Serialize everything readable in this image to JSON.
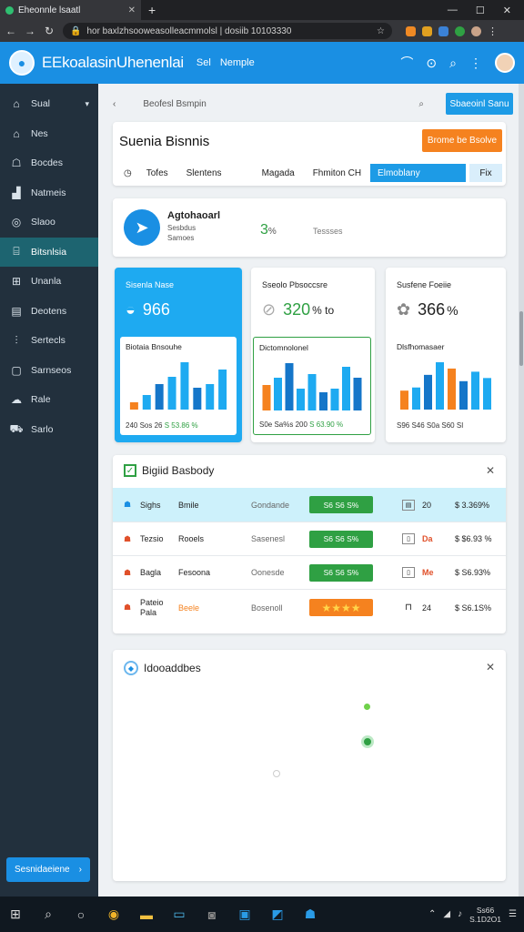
{
  "browser": {
    "tab_title": "Eheonnle lsaatl",
    "address": "hor baxlzhsooweasolleacmmolsl | dosiib 10103330"
  },
  "app": {
    "name": "EEkoalasinUhenenlai",
    "nav": [
      "Sel",
      "Nemple"
    ]
  },
  "sidebar": {
    "items": [
      {
        "label": "Sual",
        "icon": "dashboard-icon"
      },
      {
        "label": "Nes",
        "icon": "home-icon"
      },
      {
        "label": "Bocdes",
        "icon": "box-icon"
      },
      {
        "label": "Natmeis",
        "icon": "chart-icon"
      },
      {
        "label": "Slaoo",
        "icon": "settings-icon"
      },
      {
        "label": "Bitsnlsia",
        "icon": "building-icon",
        "active": true
      },
      {
        "label": "Unanla",
        "icon": "table-icon"
      },
      {
        "label": "Deotens",
        "icon": "calendar-icon"
      },
      {
        "label": "Sertecls",
        "icon": "analytics-icon"
      },
      {
        "label": "Sarnseos",
        "icon": "book-icon"
      },
      {
        "label": "Rale",
        "icon": "cloud-icon"
      },
      {
        "label": "Sarlo",
        "icon": "cart-icon"
      }
    ],
    "cta": "Sesnidaeiene"
  },
  "topbar": {
    "breadcrumb": "Beofesl Bsmpin",
    "action_button": "Sbaeoinl Sanu"
  },
  "hero": {
    "title": "Suenia Bisnnis",
    "orange_button": "Brome be Bsolve",
    "tabs": [
      "Tofes",
      "Slentens",
      "Magada",
      "Fhmiton CH",
      "Elmoblany",
      "Fix"
    ]
  },
  "overview": {
    "name": "Agtohaoarl",
    "sub1": "Sesbdus",
    "sub2": "Samoes",
    "pct": "3",
    "pct_unit": "%",
    "label": "Tessses"
  },
  "stats": [
    {
      "head": "Sisenla Nase",
      "value": "966",
      "chart_title": "Biotaia Bnsouhe",
      "footer": "240 Sos 26",
      "footer_green": "S 53.86 %",
      "bars": [
        2,
        4,
        7,
        9,
        13,
        6,
        7,
        11
      ]
    },
    {
      "head": "Sseolo Pbsoccsre",
      "value": "320",
      "unit": "% to",
      "chart_title": "Dictomnolonel",
      "footer": "S0e Sa%s 200",
      "footer_green": "S 63.90 %",
      "bars": [
        7,
        9,
        13,
        6,
        10,
        5,
        6,
        12,
        9
      ]
    },
    {
      "head": "Susfene Foeiie",
      "value": "366",
      "unit": "%",
      "chart_title": "Dlsfhomasaer",
      "footer": "S96 S46 S0a S60 SI",
      "footer_green": "",
      "bars": [
        6,
        7,
        11,
        15,
        13,
        9,
        12,
        10
      ]
    }
  ],
  "table": {
    "title": "Bigiid Basbody",
    "rows": [
      {
        "icon": "user-icon",
        "name": "Sighs",
        "col": "Bmile",
        "status": "Gondande",
        "badge": "S6 S6 S%",
        "badge_color": "#2fa043",
        "num": "20",
        "amount": "$ 3.369%"
      },
      {
        "icon": "user-icon",
        "name": "Tezsio",
        "col": "Rooels",
        "status": "Sasenesl",
        "badge": "S6 S6 S%",
        "badge_color": "#2fa043",
        "num": "Da",
        "amount": "$ $6.93 %"
      },
      {
        "icon": "user-icon",
        "name": "Bagla",
        "col": "Fesoona",
        "status": "Oonesde",
        "badge": "S6 S6 S%",
        "badge_color": "#2fa043",
        "num": "Me",
        "amount": "$ S6.93%"
      },
      {
        "icon": "user-icon",
        "name": "Pateio Pala",
        "col": "Beele",
        "status": "Bosenoll",
        "badge": "★★★★",
        "badge_color": "#f5821f",
        "num": "24",
        "amount": "$ S6.1S%"
      }
    ]
  },
  "empty_panel": {
    "title": "Idooaddbes"
  },
  "taskbar": {
    "time": "Ss66",
    "date": "S.1D2O1"
  }
}
